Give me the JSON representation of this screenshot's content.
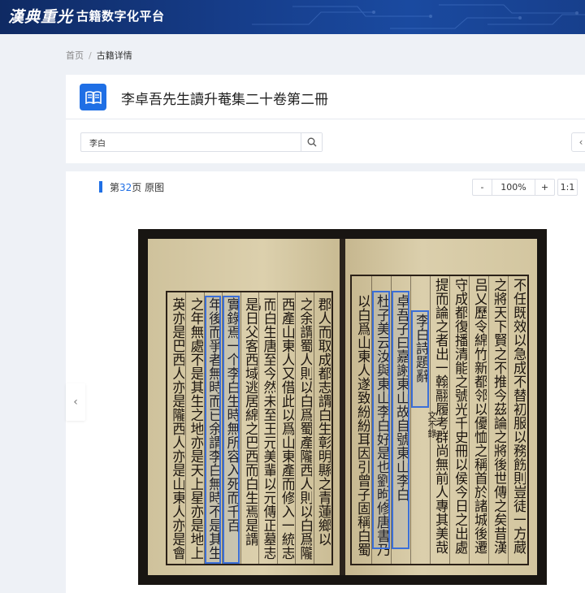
{
  "header": {
    "logo_text": "漢典重光",
    "platform_name": "古籍数字化平台"
  },
  "breadcrumb": {
    "home": "首页",
    "separator": "/",
    "current": "古籍详情"
  },
  "book": {
    "title": "李卓吾先生讀升菴集二十卷第二冊",
    "icon": "book-open-icon"
  },
  "search": {
    "value": "李白",
    "icon": "search-icon"
  },
  "viewer": {
    "page_prefix": "第",
    "page_number": "32",
    "page_suffix": "页",
    "view_mode": "原图",
    "zoom_out": "-",
    "zoom_value": "100%",
    "zoom_in": "+",
    "actual_size": "1:1"
  },
  "scan": {
    "left_columns": [
      "郡人而取成都志謂白生彰明縣之青蓮鄉以",
      "之余謂蜀人則以白爲蜀產隴西人則以白爲隴",
      "西產山東人又借此以爲山東產而修入一統志",
      "而白生唐至今然未至王元美輩以元傳正墓志爲",
      "是日父客西域逃居綿之巴西而白生焉是謂",
      "實錄焉一个李白生時無所容入死而千百",
      "年後而爭者無時而已余謂李白無時不是其生",
      "之年無處不是其生之地亦是天上星亦是地上",
      "英亦是巴西人亦是隴西人亦是山東人亦是會"
    ],
    "right_columns": [
      "不任既效以急成不替初服以務飭則豈徒一方蔵",
      "之將天下賢之不推今茲論之將後世傳之矣昔漢",
      "吕乂歷令綿竹新都邻以優恤之稱首於諸城後遷",
      "守成都復播清能之號光千史冊以侯今日之出處",
      "提而論之者出一翰翮履考群尚無前人專其美哉",
      "李白詩題辭",
      "卓吾子曰嘉謝東山故自號東山李白",
      "杜子美云汝與東山李白好是也劉昫修唐書乃",
      "以白爲山東人遂致紛紛耳因引曾子固稱白蜀"
    ],
    "right_notes": [
      "文不錄"
    ]
  }
}
